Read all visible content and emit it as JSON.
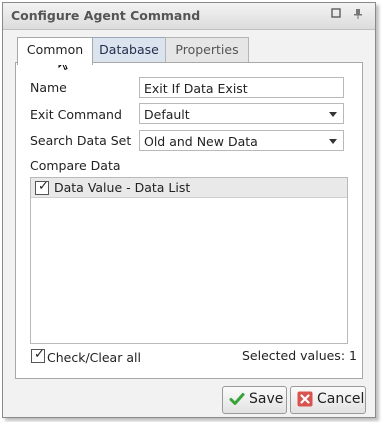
{
  "window": {
    "title": "Configure Agent Command"
  },
  "tabs": [
    {
      "label": "Common",
      "active": true
    },
    {
      "label": "Database",
      "active": false
    },
    {
      "label": "Properties",
      "active": false
    }
  ],
  "form": {
    "name_label": "Name",
    "name_value": "Exit If Data Exist",
    "exit_command_label": "Exit Command",
    "exit_command_value": "Default",
    "search_data_set_label": "Search Data Set",
    "search_data_set_value": "Old and New Data",
    "compare_data_label": "Compare Data",
    "compare_items": [
      {
        "label": "Data Value - Data List",
        "checked": true
      }
    ],
    "check_clear_all_label": "Check/Clear all",
    "selected_values_text": "Selected values: 1"
  },
  "buttons": {
    "save": "Save",
    "cancel": "Cancel"
  },
  "colors": {
    "save_icon": "#3aa23a",
    "cancel_icon": "#d9534f"
  }
}
